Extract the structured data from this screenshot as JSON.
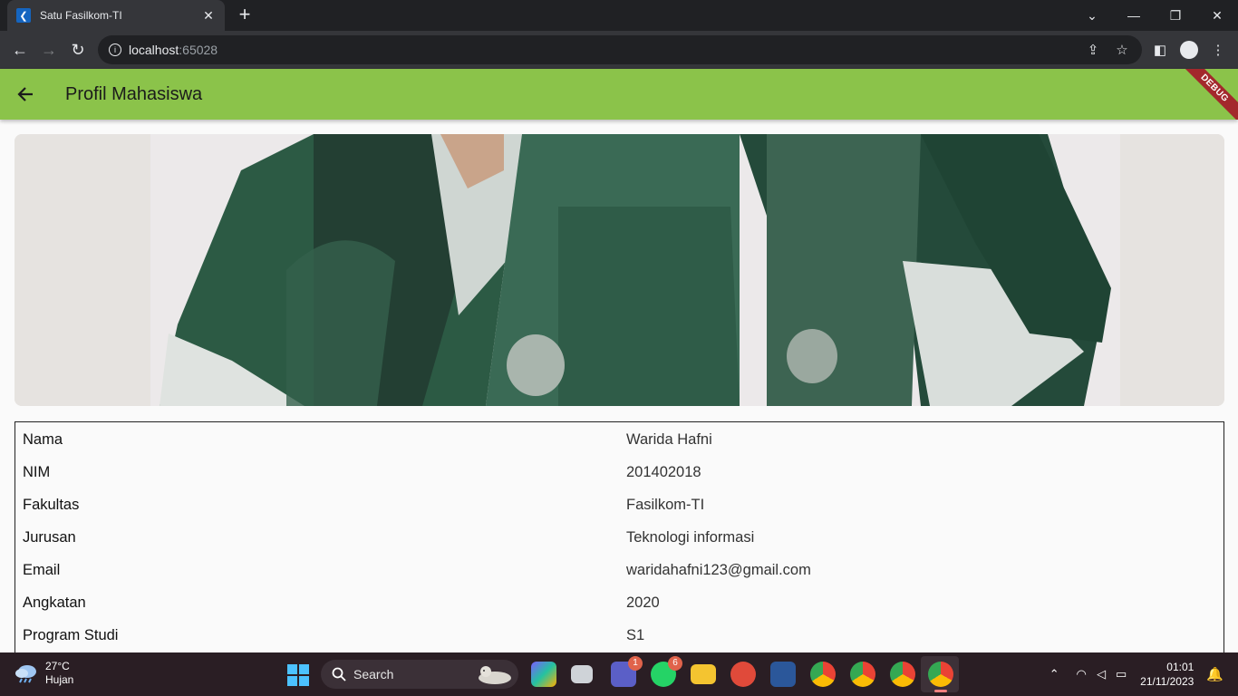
{
  "browser": {
    "tab_title": "Satu Fasilkom-TI",
    "url_host": "localhost",
    "url_port": ":65028"
  },
  "app": {
    "title": "Profil Mahasiswa",
    "debug_label": "DEBUG",
    "accent_color": "#8bc34a"
  },
  "profile": {
    "rows": [
      {
        "label": "Nama",
        "value": "Warida Hafni"
      },
      {
        "label": "NIM",
        "value": "201402018"
      },
      {
        "label": "Fakultas",
        "value": "Fasilkom-TI"
      },
      {
        "label": "Jurusan",
        "value": "Teknologi informasi"
      },
      {
        "label": "Email",
        "value": "waridahafni123@gmail.com"
      },
      {
        "label": "Angkatan",
        "value": "2020"
      },
      {
        "label": "Program Studi",
        "value": "S1"
      }
    ]
  },
  "taskbar": {
    "weather_temp": "27°C",
    "weather_desc": "Hujan",
    "search_label": "Search",
    "teams_badge": "1",
    "whatsapp_badge": "6",
    "time": "01:01",
    "date": "21/11/2023"
  }
}
